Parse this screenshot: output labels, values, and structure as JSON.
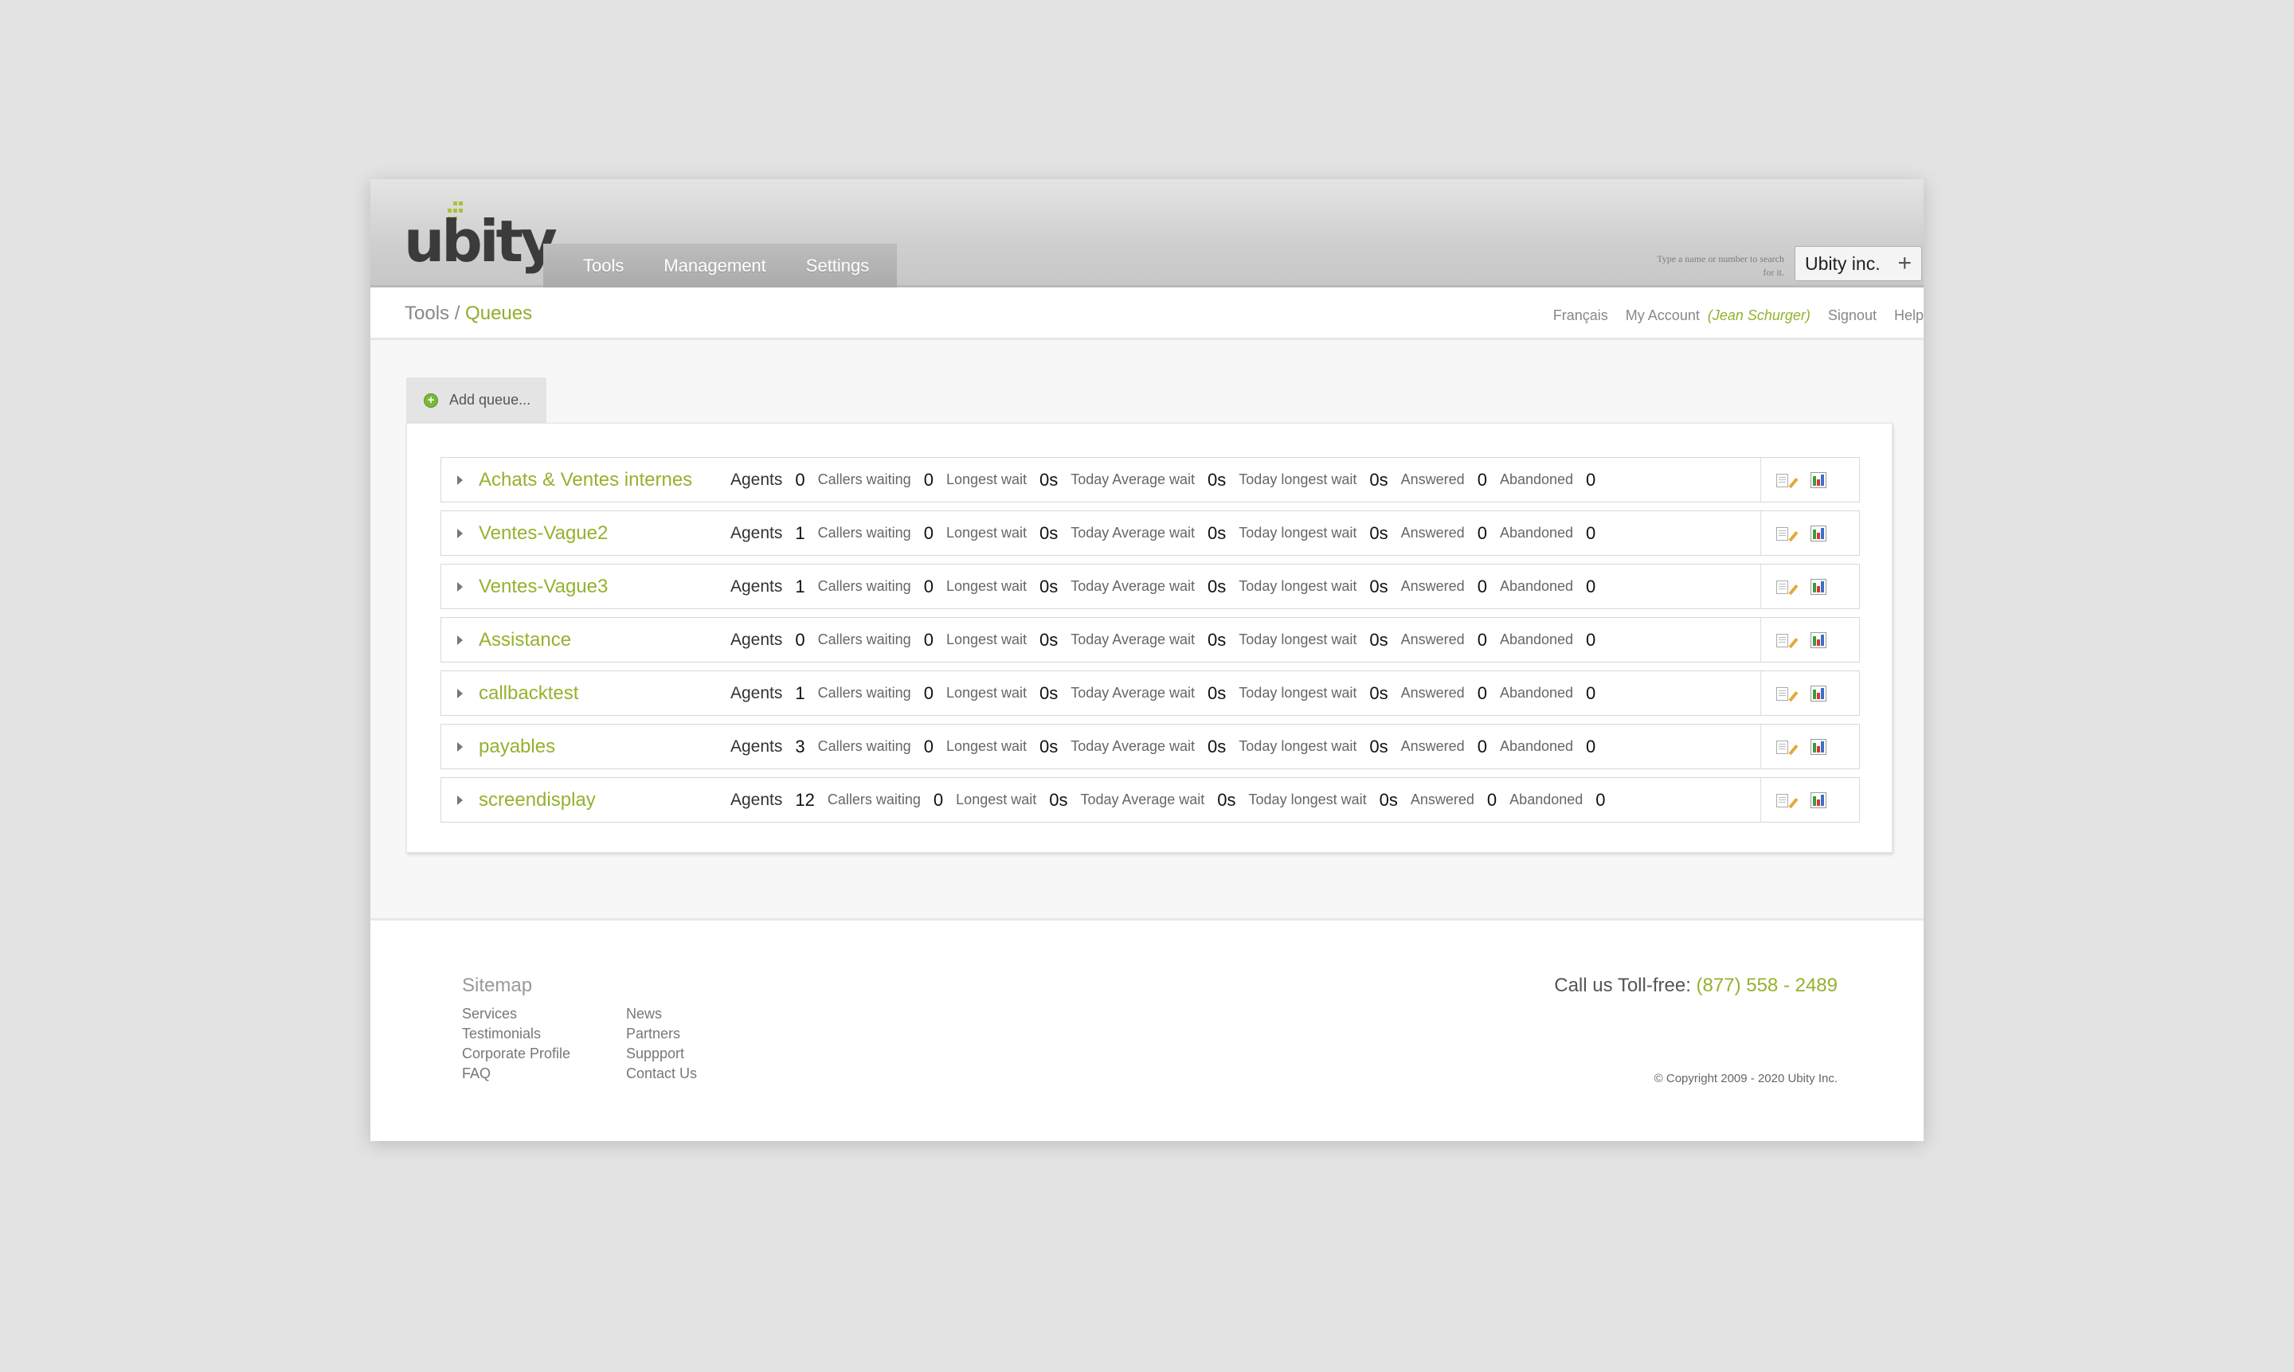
{
  "brand": {
    "logo_text": "ubity"
  },
  "nav": [
    "Tools",
    "Management",
    "Settings"
  ],
  "search": {
    "hint": "Type a name or number to search for it.",
    "company": "Ubity inc.",
    "add_symbol": "+"
  },
  "breadcrumb": {
    "root": "Tools",
    "separator": " / ",
    "current": "Queues"
  },
  "top_links": {
    "language": "Français",
    "account": "My Account",
    "user": "(Jean Schurger)",
    "signout": "Signout",
    "help": "Help"
  },
  "add_queue_label": "Add queue...",
  "stat_labels": {
    "agents": "Agents",
    "callers_waiting": "Callers waiting",
    "longest_wait": "Longest wait",
    "today_avg_wait": "Today Average wait",
    "today_longest_wait": "Today longest wait",
    "answered": "Answered",
    "abandoned": "Abandoned"
  },
  "queues": [
    {
      "name": "Achats & Ventes internes",
      "agents": "0",
      "callers_waiting": "0",
      "longest_wait": "0s",
      "today_avg_wait": "0s",
      "today_longest_wait": "0s",
      "answered": "0",
      "abandoned": "0"
    },
    {
      "name": "Ventes-Vague2",
      "agents": "1",
      "callers_waiting": "0",
      "longest_wait": "0s",
      "today_avg_wait": "0s",
      "today_longest_wait": "0s",
      "answered": "0",
      "abandoned": "0"
    },
    {
      "name": "Ventes-Vague3",
      "agents": "1",
      "callers_waiting": "0",
      "longest_wait": "0s",
      "today_avg_wait": "0s",
      "today_longest_wait": "0s",
      "answered": "0",
      "abandoned": "0"
    },
    {
      "name": "Assistance",
      "agents": "0",
      "callers_waiting": "0",
      "longest_wait": "0s",
      "today_avg_wait": "0s",
      "today_longest_wait": "0s",
      "answered": "0",
      "abandoned": "0"
    },
    {
      "name": "callbacktest",
      "agents": "1",
      "callers_waiting": "0",
      "longest_wait": "0s",
      "today_avg_wait": "0s",
      "today_longest_wait": "0s",
      "answered": "0",
      "abandoned": "0"
    },
    {
      "name": "payables",
      "agents": "3",
      "callers_waiting": "0",
      "longest_wait": "0s",
      "today_avg_wait": "0s",
      "today_longest_wait": "0s",
      "answered": "0",
      "abandoned": "0"
    },
    {
      "name": "screendisplay",
      "agents": "12",
      "callers_waiting": "0",
      "longest_wait": "0s",
      "today_avg_wait": "0s",
      "today_longest_wait": "0s",
      "answered": "0",
      "abandoned": "0"
    }
  ],
  "footer": {
    "sitemap_title": "Sitemap",
    "col1": [
      "Services",
      "Testimonials",
      "Corporate Profile",
      "FAQ"
    ],
    "col2": [
      "News",
      "Partners",
      "Suppport",
      "Contact Us"
    ],
    "tollfree_label": "Call us Toll-free: ",
    "tollfree_number": "(877) 558 - 2489",
    "copyright": "© Copyright 2009 - 2020 Ubity Inc."
  },
  "colors": {
    "accent": "#94b22e",
    "background": "#e3e3e3"
  }
}
